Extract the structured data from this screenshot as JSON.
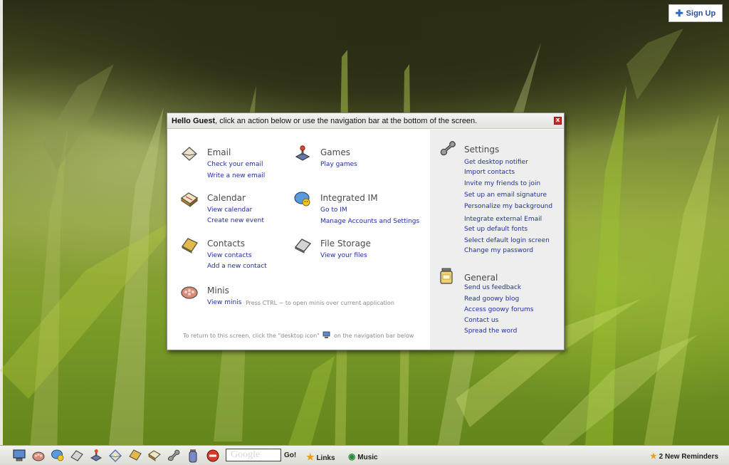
{
  "header": {
    "signup_label": "Sign Up"
  },
  "dialog": {
    "greeting_bold": "Hello Guest",
    "greeting_rest": ", click an action below or use the navigation bar at the bottom of the screen.",
    "close_label": "x",
    "email": {
      "title": "Email",
      "links": [
        "Check your email",
        "Write a new email"
      ]
    },
    "games": {
      "title": "Games",
      "links": [
        "Play games"
      ]
    },
    "calendar": {
      "title": "Calendar",
      "links": [
        "View calendar",
        "Create new event"
      ]
    },
    "im": {
      "title": "Integrated IM",
      "links": [
        "Go to IM",
        "Manage Accounts and Settings"
      ]
    },
    "contacts": {
      "title": "Contacts",
      "links": [
        "View contacts",
        "Add a new contact"
      ]
    },
    "files": {
      "title": "File Storage",
      "links": [
        "View your files"
      ]
    },
    "minis": {
      "title": "Minis",
      "links": [
        "View minis"
      ],
      "hint": "Press CTRL ~ to open minis over current application"
    },
    "footer_before": "To return to this screen, click the \"desktop icon\"",
    "footer_after": "on the navigation bar below",
    "settings": {
      "title": "Settings",
      "links": [
        "Get desktop notifier",
        "Import contacts",
        "Invite my friends to join",
        "Set up an email signature",
        "Personalize my background",
        "Integrate external Email",
        "Set up default fonts",
        "Select default login screen",
        "Change my password"
      ]
    },
    "general": {
      "title": "General",
      "links": [
        "Send us feedback",
        "Read goowy blog",
        "Access goowy forums",
        "Contact us",
        "Spread the word"
      ]
    }
  },
  "taskbar": {
    "icons": [
      "desktop-icon",
      "minis-icon",
      "im-icon",
      "file-storage-icon",
      "games-icon",
      "email-icon",
      "contacts-icon",
      "calendar-icon",
      "settings-icon",
      "general-icon",
      "stop-icon"
    ],
    "google_placeholder": "Google",
    "go_label": "Go!",
    "links_label": "Links",
    "music_label": "Music",
    "reminders_label": "2 New Reminders"
  }
}
